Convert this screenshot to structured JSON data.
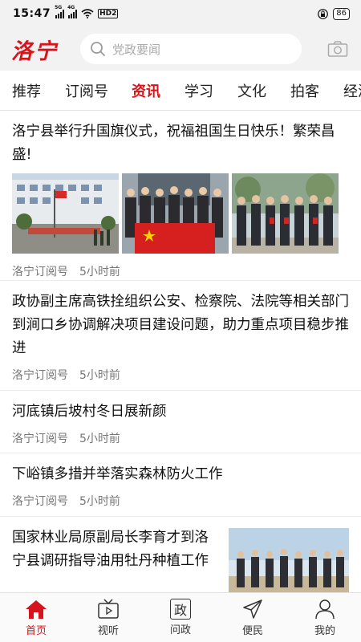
{
  "status_bar": {
    "time": "15:47",
    "signal1": "5G",
    "signal2": "4G",
    "hd": "HD2",
    "battery": "86"
  },
  "header": {
    "logo": "洛宁",
    "search_placeholder": "党政要闻"
  },
  "tabs": [
    "推荐",
    "订阅号",
    "资讯",
    "学习",
    "文化",
    "拍客",
    "经济"
  ],
  "active_tab": "资讯",
  "news": [
    {
      "title": "洛宁县举行升国旗仪式，祝福祖国生日快乐！繁荣昌盛!",
      "source": "洛宁订阅号",
      "time": "5小时前"
    },
    {
      "title": "政协副主席高铁拴组织公安、检察院、法院等相关部门到涧口乡协调解决项目建设问题，助力重点项目稳步推进",
      "source": "洛宁订阅号",
      "time": "5小时前"
    },
    {
      "title": "河底镇后坡村冬日展新颜",
      "source": "洛宁订阅号",
      "time": "5小时前"
    },
    {
      "title": "下峪镇多措并举落实森林防火工作",
      "source": "洛宁订阅号",
      "time": "5小时前"
    },
    {
      "title": "国家林业局原副局长李育才到洛宁县调研指导油用牡丹种植工作"
    }
  ],
  "bottom_nav": [
    {
      "label": "首页",
      "icon": "home-icon"
    },
    {
      "label": "视听",
      "icon": "tv-icon"
    },
    {
      "label": "问政",
      "icon": "zheng-icon",
      "glyph": "政"
    },
    {
      "label": "便民",
      "icon": "send-icon"
    },
    {
      "label": "我的",
      "icon": "user-icon"
    }
  ],
  "colors": {
    "accent": "#d7141b",
    "header_bg": "#f2f2f2",
    "meta_text": "#777777"
  }
}
